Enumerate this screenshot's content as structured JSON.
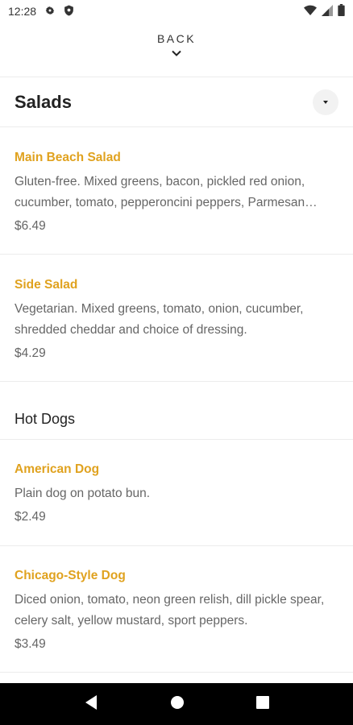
{
  "status": {
    "time": "12:28"
  },
  "nav": {
    "back_label": "BACK"
  },
  "sections": [
    {
      "title": "Salads",
      "items": [
        {
          "name": "Main Beach Salad",
          "description": "Gluten-free. Mixed greens, bacon, pickled red onion, cucumber, tomato, pepperoncini peppers, Parmesan cheese and choice of dressing.",
          "price": "$6.49"
        },
        {
          "name": "Side Salad",
          "description": "Vegetarian. Mixed greens, tomato, onion, cucumber, shredded cheddar and choice of dressing.",
          "price": "$4.29"
        }
      ]
    },
    {
      "title": "Hot Dogs",
      "items": [
        {
          "name": "American Dog",
          "description": "Plain dog on potato bun.",
          "price": "$2.49"
        },
        {
          "name": "Chicago-Style Dog",
          "description": "Diced onion, tomato, neon green relish, dill pickle spear, celery salt, yellow mustard, sport peppers.",
          "price": "$3.49"
        }
      ]
    }
  ],
  "colors": {
    "accent": "#e0a21f",
    "text": "#222222",
    "muted": "#666666"
  }
}
